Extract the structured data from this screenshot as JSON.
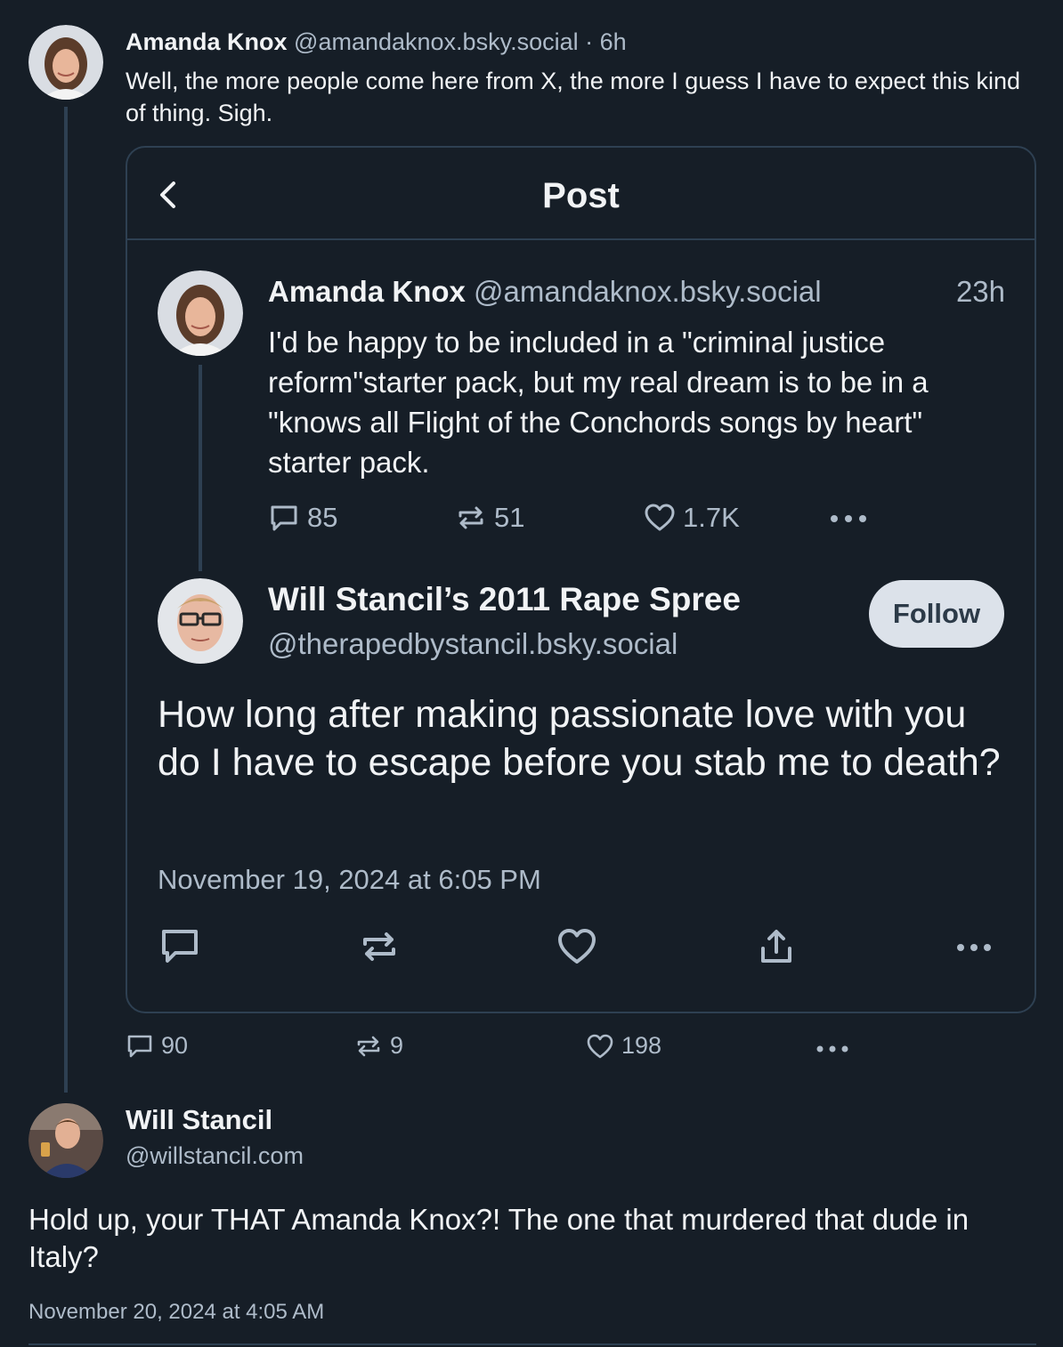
{
  "top_post": {
    "author_name": "Amanda Knox",
    "handle": "@amandaknox.bsky.social",
    "time": "· 6h",
    "text": "Well, the more people come here from X, the more I guess I have to expect this kind of thing. Sigh.",
    "stats": {
      "replies": "90",
      "reposts": "9",
      "likes": "198"
    }
  },
  "screenshot": {
    "header_title": "Post",
    "parent_post": {
      "author_name": "Amanda Knox",
      "handle": "@amandaknox.bsky.social",
      "time": "23h",
      "text": "I'd be happy to be included in a \"criminal justice reform\"starter pack, but my real dream is to be in a \"knows all Flight of the Conchords songs by heart\" starter pack.",
      "stats": {
        "replies": "85",
        "reposts": "51",
        "likes": "1.7K"
      }
    },
    "focused_post": {
      "author_name": "Will Stancil’s 2011 Rape Spree",
      "handle": "@therapedbystancil.bsky.social",
      "follow_label": "Follow",
      "text": "How long after making passionate love with you do I have to escape before you stab me to death?",
      "timestamp": "November 19, 2024 at 6:05 PM"
    }
  },
  "reply_post": {
    "author_name": "Will Stancil",
    "handle": "@willstancil.com",
    "text": "Hold up, your THAT Amanda Knox?! The one that murdered that dude in Italy?",
    "timestamp": "November 20, 2024 at 4:05 AM"
  },
  "colors": {
    "background": "#161e27",
    "border": "#2e4052",
    "muted_text": "#aebbc9",
    "follow_bg": "#dce2ea"
  }
}
